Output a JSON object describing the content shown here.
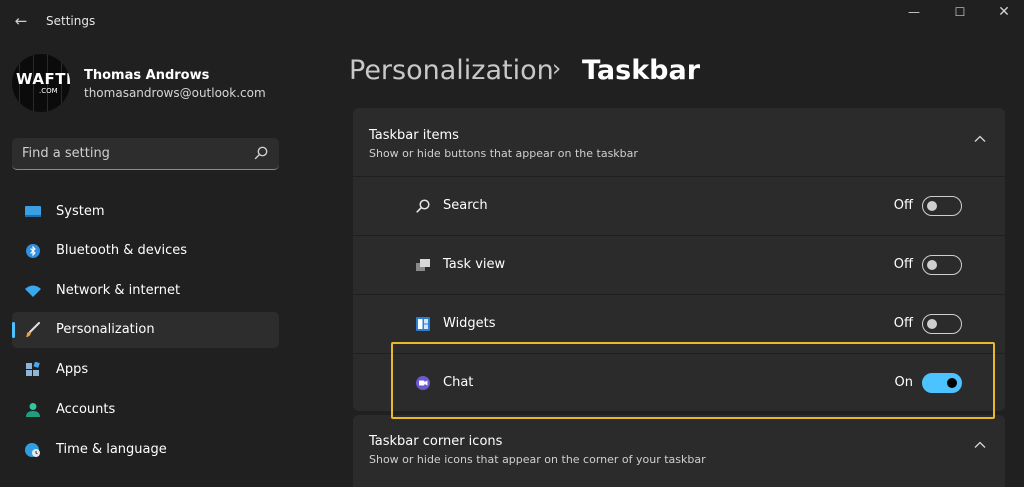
{
  "window": {
    "title": "Settings",
    "back_icon": "arrow-left-icon",
    "controls": {
      "minimize": "—",
      "maximize": "☐",
      "close": "✕"
    }
  },
  "profile": {
    "name": "Thomas Androws",
    "email": "thomasandrows@outlook.com",
    "avatar_text": "WAFTR",
    "avatar_subtext": ".COM"
  },
  "search": {
    "placeholder": "Find a setting",
    "icon": "search-icon"
  },
  "sidebar": {
    "items": [
      {
        "label": "System",
        "icon": "system-display-icon",
        "selected": false
      },
      {
        "label": "Bluetooth & devices",
        "icon": "bluetooth-icon",
        "selected": false
      },
      {
        "label": "Network & internet",
        "icon": "wifi-icon",
        "selected": false
      },
      {
        "label": "Personalization",
        "icon": "paintbrush-icon",
        "selected": true
      },
      {
        "label": "Apps",
        "icon": "apps-icon",
        "selected": false
      },
      {
        "label": "Accounts",
        "icon": "person-icon",
        "selected": false
      },
      {
        "label": "Time & language",
        "icon": "globe-clock-icon",
        "selected": false
      }
    ]
  },
  "breadcrumb": {
    "parent": "Personalization",
    "separator": "›",
    "current": "Taskbar"
  },
  "taskbar_items": {
    "title": "Taskbar items",
    "subtitle": "Show or hide buttons that appear on the taskbar",
    "expanded": true,
    "rows": [
      {
        "label": "Search",
        "icon": "search-icon",
        "state_label": "Off",
        "on": false
      },
      {
        "label": "Task view",
        "icon": "task-view-icon",
        "state_label": "Off",
        "on": false
      },
      {
        "label": "Widgets",
        "icon": "widgets-icon",
        "state_label": "Off",
        "on": false
      },
      {
        "label": "Chat",
        "icon": "chat-icon",
        "state_label": "On",
        "on": true
      }
    ]
  },
  "corner_icons": {
    "title": "Taskbar corner icons",
    "subtitle": "Show or hide icons that appear on the corner of your taskbar",
    "expanded": true
  },
  "colors": {
    "accent": "#4cc2ff",
    "highlight": "#e8b92a",
    "background": "#202020",
    "card": "#2b2b2b"
  }
}
